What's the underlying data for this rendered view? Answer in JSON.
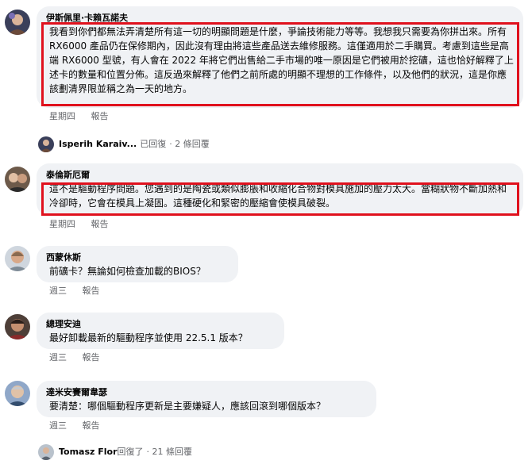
{
  "comments": [
    {
      "author": "伊斯佩里·卡賴瓦諾夫",
      "text": "我看到你們都無法弄清楚所有這一切的明顯問題是什麼，爭論技術能力等等。我想我只需要為你拼出來。所有 RX6000 產品仍在保修期內，因此沒有理由將這些產品送去維修服務。這僅適用於二手購買。考慮到這些是高端 RX6000 型號，有人會在 2022 年將它們出售給二手市場的唯一原因是它們被用於挖礦，這也恰好解釋了上述卡的數量和位置分佈。這反過來解釋了他們之前所處的明顯不理想的工作條件，以及他們的狀況，這是你應該劃清界限並稱之為一天的地方。",
      "time": "星期四",
      "report": "報告",
      "reply": {
        "name": "Isperih Karaiv...",
        "verb": "已回復",
        "count": "· 2 條回覆"
      }
    },
    {
      "author": "泰倫斯厄爾",
      "text": "這不是驅動程序問題。您遇到的是陶瓷或類似膨脹和收縮化合物對模具施加的壓力太大。當糊狀物不斷加熱和冷卻時，它會在模具上凝固。這種硬化和緊密的壓縮會使模具破裂。",
      "time": "星期四",
      "report": "報告"
    },
    {
      "author": "西蒙休斯",
      "text": "前礦卡？無論如何檢查加載的BIOS？",
      "time": "週三",
      "report": "報告"
    },
    {
      "author": "總理安迪",
      "text": "最好卸載最新的驅動程序並使用 22.5.1 版本？",
      "time": "週三",
      "report": "報告"
    },
    {
      "author": "達米安賽爾韋瑟",
      "text": "要清楚：哪個驅動程序更新是主要嫌疑人，應該回滾到哪個版本？",
      "time": "週三",
      "report": "報告",
      "reply": {
        "name": "Tomasz Flor",
        "verb": "回復了",
        "count": "· 21 條回覆"
      }
    }
  ],
  "colors": {
    "highlight": "#e0111d",
    "bubble": "#f0f2f5",
    "meta": "#65676b"
  }
}
